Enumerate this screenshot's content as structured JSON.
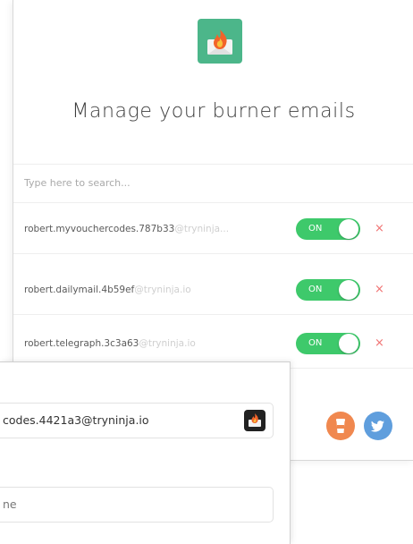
{
  "app": {
    "title": "Manage your burner emails"
  },
  "search": {
    "placeholder": "Type here to search..."
  },
  "emails": [
    {
      "local": "robert.myvouchercodes.787b33",
      "domain": "@tryninja...",
      "status": "ON",
      "delete": "×"
    },
    {
      "local": "robert.dailymail.4b59ef",
      "domain": "@tryninja.io",
      "status": "ON",
      "delete": "×"
    },
    {
      "local": "robert.telegraph.3c3a63",
      "domain": "@tryninja.io",
      "status": "ON",
      "delete": "×"
    }
  ],
  "footer": {
    "coffee_icon": "coffee-cup-icon",
    "twitter_icon": "twitter-bird-icon"
  },
  "form": {
    "email_value": "codes.4421a3@tryninja.io",
    "name_value": "ne"
  },
  "colors": {
    "brand": "#4cb68a",
    "toggle_on": "#3ec96b",
    "delete": "#f07272",
    "coffee": "#f0884f",
    "twitter": "#5f9edd"
  }
}
